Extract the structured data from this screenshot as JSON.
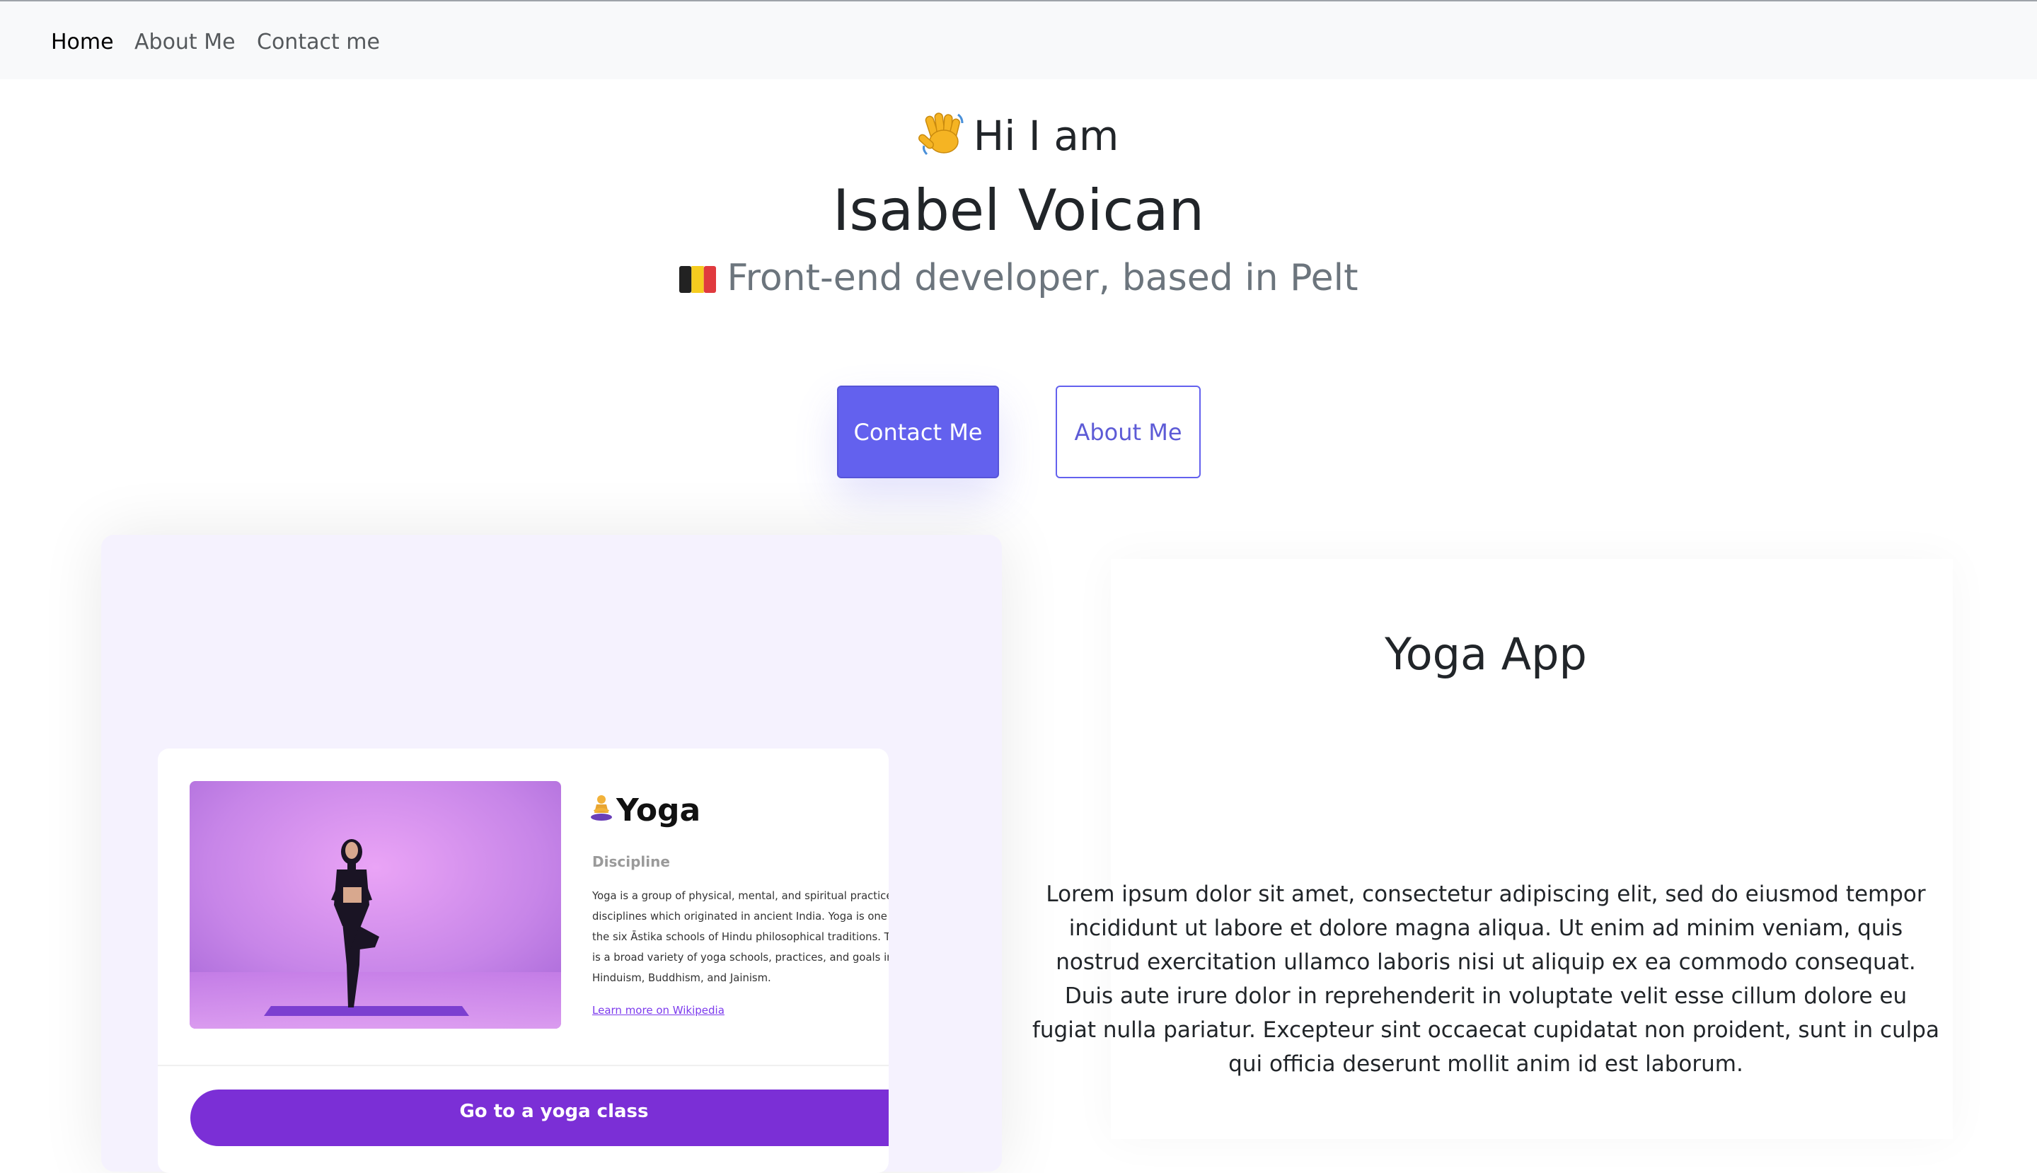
{
  "nav": {
    "items": [
      {
        "label": "Home"
      },
      {
        "label": "About Me"
      },
      {
        "label": "Contact me"
      }
    ]
  },
  "hero": {
    "greeting": "Hi I am",
    "greeting_icon": "waving-hand-emoji",
    "name": "Isabel Voican",
    "role": "Front-end developer, based in Pelt",
    "role_icon": "belgium-flag-emoji",
    "buttons": {
      "contact": "Contact Me",
      "about": "About Me"
    }
  },
  "project": {
    "title": "Yoga App",
    "description": "Lorem ipsum dolor sit amet, consectetur adipiscing elit, sed do eiusmod tempor incididunt ut labore et dolore magna aliqua. Ut enim ad minim veniam, quis nostrud exercitation ullamco laboris nisi ut aliquip ex ea commodo consequat. Duis aute irure dolor in reprehenderit in voluptate velit esse cillum dolore eu fugiat nulla pariatur. Excepteur sint occaecat cupidatat non proident, sunt in culpa qui officia deserunt mollit anim id est laborum.",
    "preview": {
      "title": "Yoga",
      "title_icon": "lotus-position-emoji",
      "category": "Discipline",
      "body": "Yoga is a group of physical, mental, and spiritual practices or disciplines which originated in ancient India. Yoga is one of the six Āstika schools of Hindu philosophical traditions. There is a broad variety of yoga schools, practices, and goals in Hinduism, Buddhism, and Jainism.",
      "link": "Learn more on Wikipedia",
      "cta": "Go to a yoga class"
    }
  },
  "colors": {
    "accent": "#6361ee",
    "navbar_bg": "#f8f9fa",
    "card_bg": "#f5f2fe",
    "cta_purple": "#7b2fd6",
    "muted_text": "#6c757d"
  }
}
